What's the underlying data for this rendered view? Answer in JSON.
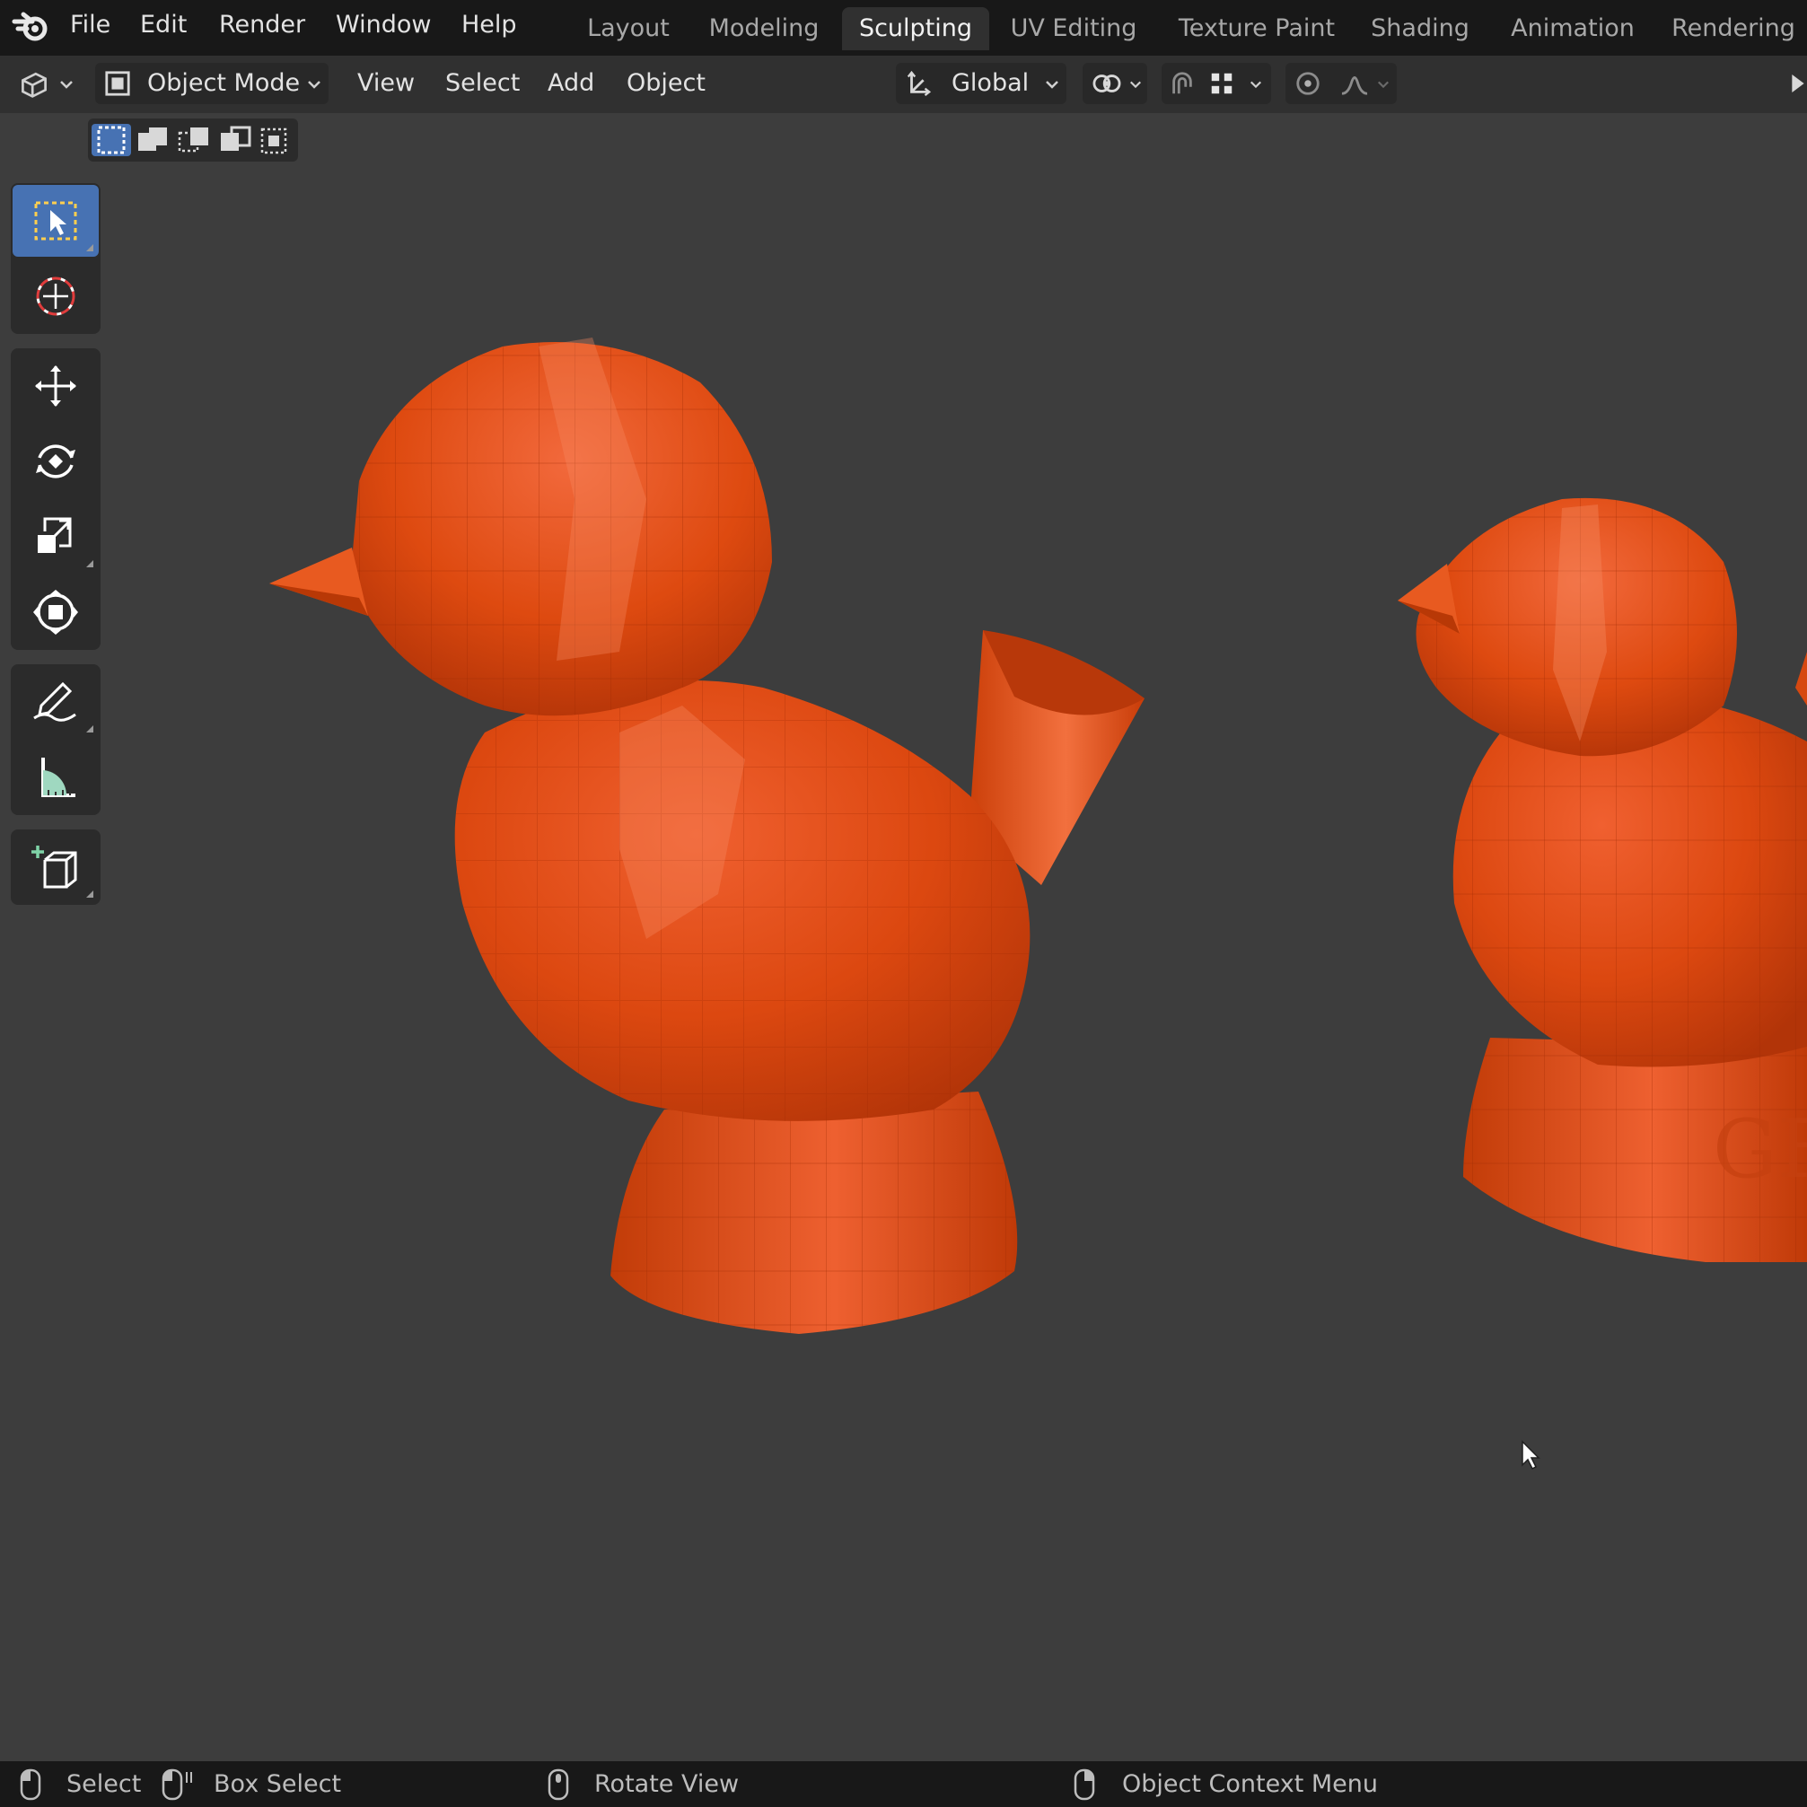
{
  "menubar": {
    "logo_icon": "blender-logo-icon",
    "items": [
      "File",
      "Edit",
      "Render",
      "Window",
      "Help"
    ]
  },
  "workspaces": {
    "tabs": [
      "Layout",
      "Modeling",
      "Sculpting",
      "UV Editing",
      "Texture Paint",
      "Shading",
      "Animation",
      "Rendering"
    ],
    "active": "Sculpting"
  },
  "header": {
    "editor_type_icon": "view3d-icon",
    "mode": "Object Mode",
    "menus": [
      "View",
      "Select",
      "Add",
      "Object"
    ],
    "transform_orientation": "Global",
    "pivot_icon": "pivot-icon",
    "snap_icon": "magnet-icon",
    "snap_target_icon": "snap-grid-icon",
    "proportional_icon": "proportional-edit-icon",
    "falloff_icon": "falloff-curve-icon"
  },
  "selection_modes": [
    "new-selection-icon",
    "extend-selection-icon",
    "subtract-selection-icon",
    "invert-selection-icon",
    "intersect-selection-icon"
  ],
  "tools": [
    "select-box-icon",
    "cursor-icon",
    "move-icon",
    "rotate-icon",
    "scale-icon",
    "transform-icon",
    "annotate-icon",
    "measure-icon",
    "add-cube-icon"
  ],
  "status_bar": {
    "items": [
      {
        "icon": "mouse-left-icon",
        "label": "Select"
      },
      {
        "icon": "mouse-left-drag-icon",
        "label": "Box Select"
      },
      {
        "icon": "mouse-middle-icon",
        "label": "Rotate View"
      },
      {
        "icon": "mouse-right-icon",
        "label": "Object Context Menu"
      }
    ]
  },
  "colors": {
    "accent": "#4772b3",
    "object": "#e0460e",
    "background": "#3d3d3d"
  }
}
